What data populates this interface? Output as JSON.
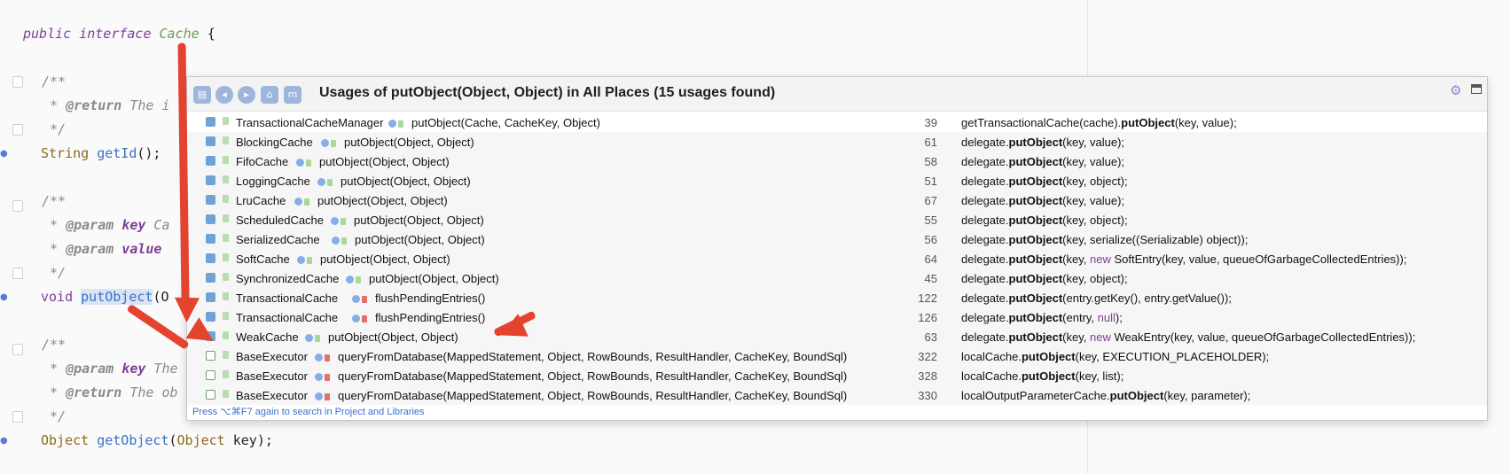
{
  "editor": {
    "lines": [
      {
        "text": "public interface Cache {"
      },
      {
        "text": "/**"
      },
      {
        "text": "* @return The i"
      },
      {
        "text": "*/"
      },
      {
        "text": "String getId();"
      },
      {
        "text": "/**"
      },
      {
        "text": "* @param key Ca"
      },
      {
        "text": "* @param value"
      },
      {
        "text": "*/"
      },
      {
        "text": "void putObject(O"
      },
      {
        "text": "/**"
      },
      {
        "text": "* @param key The"
      },
      {
        "text": "* @return The ob"
      },
      {
        "text": "*/"
      },
      {
        "text": "Object getObject(Object key);"
      }
    ]
  },
  "popup": {
    "title": "Usages of putObject(Object, Object) in All Places (15 usages found)",
    "footer": "Press ⌥⌘F7 again to search in Project and Libraries",
    "toolbar_icons": [
      "file-icon",
      "navigate-back-icon",
      "navigate-forward-icon",
      "group-icon",
      "method-icon"
    ],
    "rows": [
      {
        "cls": "TransactionalCacheManager",
        "method": "putObject(Cache, CacheKey, Object)",
        "line": "39",
        "ctx_pre": "getTransactionalCache(cache).",
        "ctx_bold": "putObject",
        "ctx_post": "(key, value);",
        "icon": "class",
        "lock": "green"
      },
      {
        "cls": "BlockingCache",
        "method": "putObject(Object, Object)",
        "line": "61",
        "ctx_pre": "delegate.",
        "ctx_bold": "putObject",
        "ctx_post": "(key, value);",
        "icon": "class",
        "lock": "green"
      },
      {
        "cls": "FifoCache",
        "method": "putObject(Object, Object)",
        "line": "58",
        "ctx_pre": "delegate.",
        "ctx_bold": "putObject",
        "ctx_post": "(key, value);",
        "icon": "class",
        "lock": "green"
      },
      {
        "cls": "LoggingCache",
        "method": "putObject(Object, Object)",
        "line": "51",
        "ctx_pre": "delegate.",
        "ctx_bold": "putObject",
        "ctx_post": "(key, object);",
        "icon": "class",
        "lock": "green"
      },
      {
        "cls": "LruCache",
        "method": "putObject(Object, Object)",
        "line": "67",
        "ctx_pre": "delegate.",
        "ctx_bold": "putObject",
        "ctx_post": "(key, value);",
        "icon": "class",
        "lock": "green"
      },
      {
        "cls": "ScheduledCache",
        "method": "putObject(Object, Object)",
        "line": "55",
        "ctx_pre": "delegate.",
        "ctx_bold": "putObject",
        "ctx_post": "(key, object);",
        "icon": "class",
        "lock": "green"
      },
      {
        "cls": "SerializedCache",
        "method": "putObject(Object, Object)",
        "line": "56",
        "ctx_pre": "delegate.",
        "ctx_bold": "putObject",
        "ctx_post": "(key, serialize((Serializable) object));",
        "icon": "class",
        "lock": "green"
      },
      {
        "cls": "SoftCache",
        "method": "putObject(Object, Object)",
        "line": "64",
        "ctx_pre": "delegate.",
        "ctx_bold": "putObject",
        "ctx_post": "(key, ",
        "ctx_new": "new",
        "ctx_post2": " SoftEntry(key, value, queueOfGarbageCollectedEntries));",
        "icon": "class",
        "lock": "green"
      },
      {
        "cls": "SynchronizedCache",
        "method": "putObject(Object, Object)",
        "line": "45",
        "ctx_pre": "delegate.",
        "ctx_bold": "putObject",
        "ctx_post": "(key, object);",
        "icon": "class",
        "lock": "green"
      },
      {
        "cls": "TransactionalCache",
        "method": "flushPendingEntries()",
        "line": "122",
        "ctx_pre": "delegate.",
        "ctx_bold": "putObject",
        "ctx_post": "(entry.getKey(), entry.getValue());",
        "icon": "class",
        "lock": "red"
      },
      {
        "cls": "TransactionalCache",
        "method": "flushPendingEntries()",
        "line": "126",
        "ctx_pre": "delegate.",
        "ctx_bold": "putObject",
        "ctx_post": "(entry, ",
        "ctx_new": "null",
        "ctx_post2": ");",
        "icon": "class",
        "lock": "red"
      },
      {
        "cls": "WeakCache",
        "method": "putObject(Object, Object)",
        "line": "63",
        "ctx_pre": "delegate.",
        "ctx_bold": "putObject",
        "ctx_post": "(key, ",
        "ctx_new": "new",
        "ctx_post2": " WeakEntry(key, value, queueOfGarbageCollectedEntries));",
        "icon": "class",
        "lock": "green"
      },
      {
        "cls": "BaseExecutor",
        "method": "queryFromDatabase(MappedStatement, Object, RowBounds, ResultHandler, CacheKey, BoundSql)",
        "line": "322",
        "ctx_pre": "localCache.",
        "ctx_bold": "putObject",
        "ctx_post": "(key, EXECUTION_PLACEHOLDER);",
        "icon": "abstract",
        "lock": "red"
      },
      {
        "cls": "BaseExecutor",
        "method": "queryFromDatabase(MappedStatement, Object, RowBounds, ResultHandler, CacheKey, BoundSql)",
        "line": "328",
        "ctx_pre": "localCache.",
        "ctx_bold": "putObject",
        "ctx_post": "(key, list);",
        "icon": "abstract",
        "lock": "red"
      },
      {
        "cls": "BaseExecutor",
        "method": "queryFromDatabase(MappedStatement, Object, RowBounds, ResultHandler, CacheKey, BoundSql)",
        "line": "330",
        "ctx_pre": "localOutputParameterCache.",
        "ctx_bold": "putObject",
        "ctx_post": "(key, parameter);",
        "icon": "abstract",
        "lock": "red"
      }
    ]
  },
  "colors": {
    "arrow": "#e4432d",
    "accent": "#3d6fd0"
  }
}
